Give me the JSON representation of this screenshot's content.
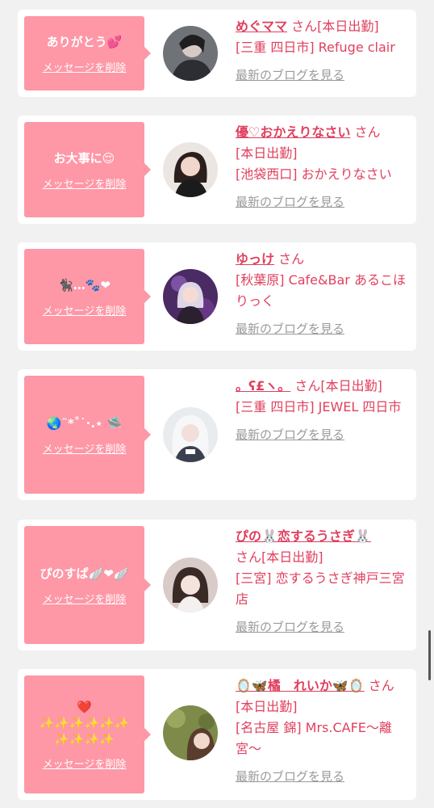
{
  "common": {
    "delete_label": "メッセージを削除",
    "blog_label": "最新のブログを見る",
    "san": "さん"
  },
  "cards": [
    {
      "message": "ありがとう💕",
      "name": "めぐママ",
      "status": "[本日出勤]",
      "shop": "[三重 四日市] Refuge clair"
    },
    {
      "message": "お大事に😌",
      "name": "優♡おかえりなさい",
      "status": "[本日出勤]",
      "shop": "[池袋西口] おかえりなさい"
    },
    {
      "message": "🐈‍⬛…🐾❤",
      "name": "ゆっけ",
      "status": "",
      "shop": "[秋葉原] Cafe&Bar あるこほりっく"
    },
    {
      "message": "🌏˜*˚˙·.⋆ 🛸",
      "name": "。ʕ£ヽ。",
      "status": "[本日出勤]",
      "shop": "[三重 四日市] JEWEL 四日市"
    },
    {
      "message": "ぴのすぱ🪽❤🪽",
      "name": "ぴの🐰恋するうさぎ🐰",
      "status": "[本日出勤]",
      "shop": "[三宮] 恋するうさぎ神戸三宮店"
    },
    {
      "message": "❤️\n✨✨✨✨✨✨\n✨✨✨✨",
      "name": "🪞🦋橘　れいか🦋🪞",
      "status": "[本日出勤]",
      "shop": "[名古屋 錦] Mrs.CAFE〜離宮〜"
    }
  ]
}
